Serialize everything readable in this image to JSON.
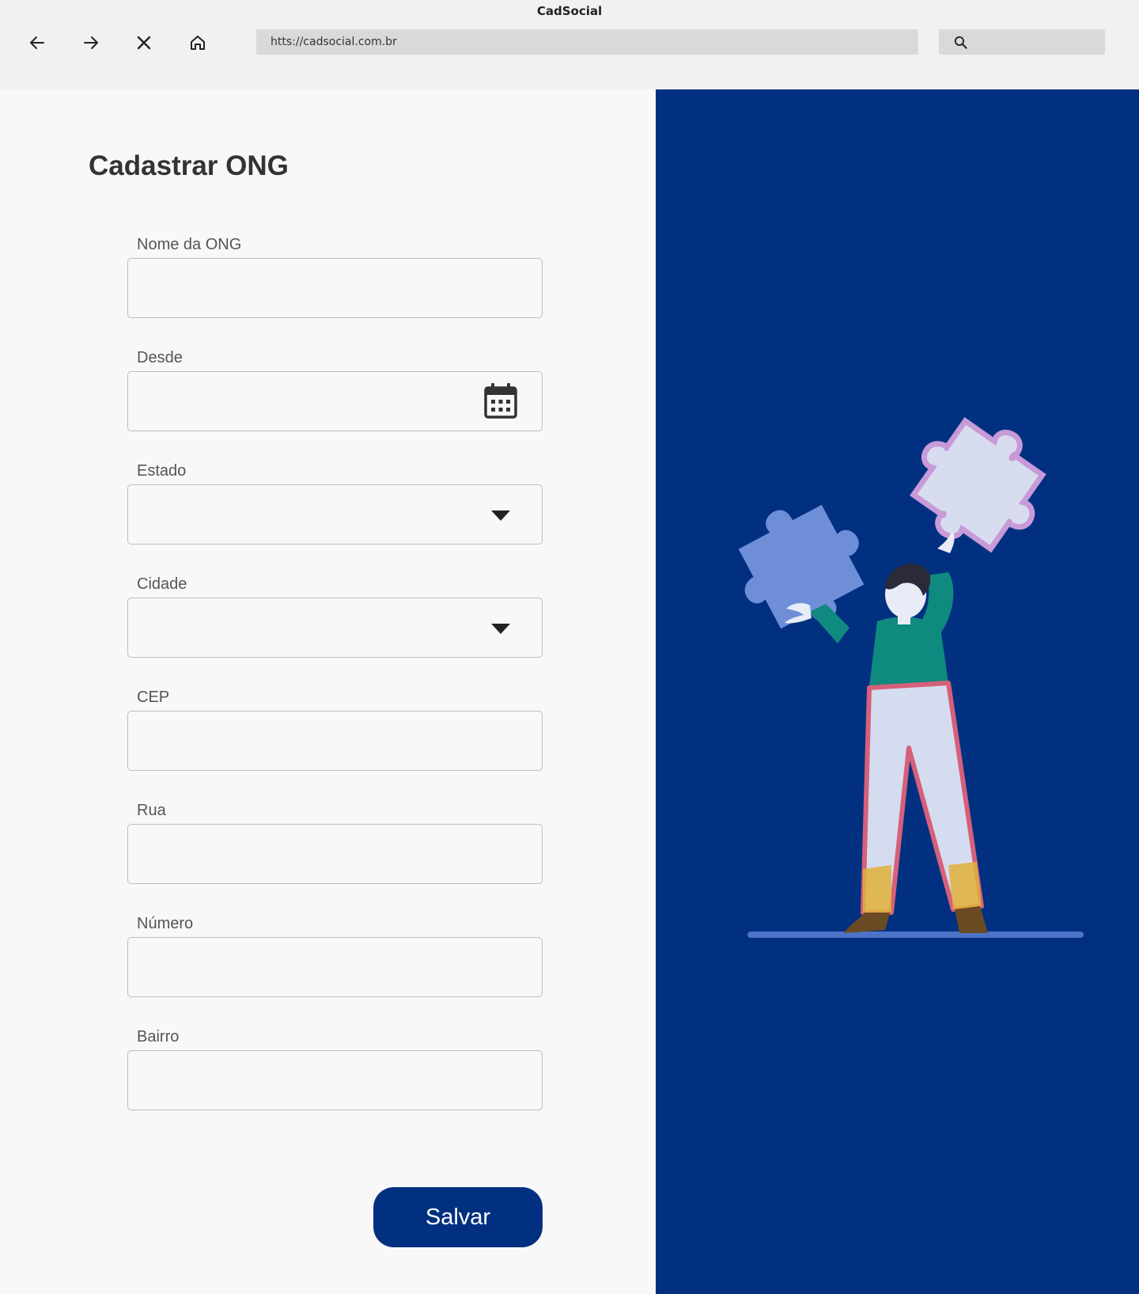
{
  "browser": {
    "window_title": "CadSocial",
    "url": "https://cadsocial.com.br",
    "url_display": "htts://cadsocial.com.br",
    "search_value": ""
  },
  "page": {
    "title": "Cadastrar ONG"
  },
  "form": {
    "fields": [
      {
        "label": "Nome da ONG",
        "type": "text",
        "value": ""
      },
      {
        "label": "Desde",
        "type": "date",
        "value": "",
        "icon": "calendar-icon"
      },
      {
        "label": "Estado",
        "type": "select",
        "value": "",
        "icon": "caret-down-icon"
      },
      {
        "label": "Cidade",
        "type": "select",
        "value": "",
        "icon": "caret-down-icon"
      },
      {
        "label": "CEP",
        "type": "text",
        "value": ""
      },
      {
        "label": "Rua",
        "type": "text",
        "value": ""
      },
      {
        "label": "Número",
        "type": "text",
        "value": ""
      },
      {
        "label": "Bairro",
        "type": "text",
        "value": ""
      }
    ],
    "submit_label": "Salvar"
  },
  "colors": {
    "brand": "#023081",
    "page_background": "#f8f8f8",
    "field_border": "#bdbdbd"
  }
}
